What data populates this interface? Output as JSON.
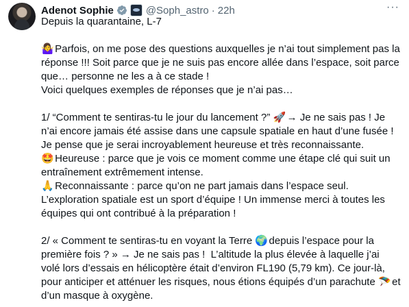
{
  "tweet": {
    "author_name": "Adenot Sophie",
    "handle": "@Soph_astro",
    "separator": "·",
    "time": "22h",
    "more_label": "···",
    "intro": "Depuis la quarantaine, L-7",
    "paragraph1_emoji": "🤷‍♀️",
    "paragraph1": " Parfois, on me pose des questions auxquelles je n’ai tout simplement pas la réponse !!! Soit parce que je ne suis pas encore allée dans l’espace, soit parce que… personne ne les a à ce stade !\nVoici quelques exemples de réponses que je n’ai pas…",
    "q1_a": "1/ “Comment te sentiras-tu le jour du lancement ?” ",
    "q1_emoji": "🚀",
    "q1_b": " → Je ne sais pas ! Je n’ai encore jamais été assise dans une capsule spatiale en haut d’une fusée ! Je pense que je serai incroyablement heureuse et très reconnaissante.",
    "happy_emoji": "🤩",
    "happy_text": " Heureuse : parce que je vois ce moment comme une étape clé qui suit un entraînement extrêmement intense.",
    "grateful_emoji": "🙏",
    "grateful_text": " Reconnaissante : parce qu’on ne part jamais dans l’espace seul. L’exploration spatiale est un sport d’équipe ! Un immense merci à toutes les équipes qui ont contribué à la préparation !",
    "q2_a": "2/ « Comment te sentiras-tu en voyant la Terre ",
    "q2_emoji": "🌍",
    "q2_b": " depuis l’espace pour la première fois ? » → Je ne sais pas !  L’altitude la plus élevée à laquelle j’ai volé lors d’essais en hélicoptère était d’environ FL190 (5,79 km). Ce jour-là, pour anticiper et atténuer les risques, nous étions équipés d’un parachute ",
    "parachute_emoji": "🪂",
    "q2_c": " et d’un masque à oxygène."
  }
}
